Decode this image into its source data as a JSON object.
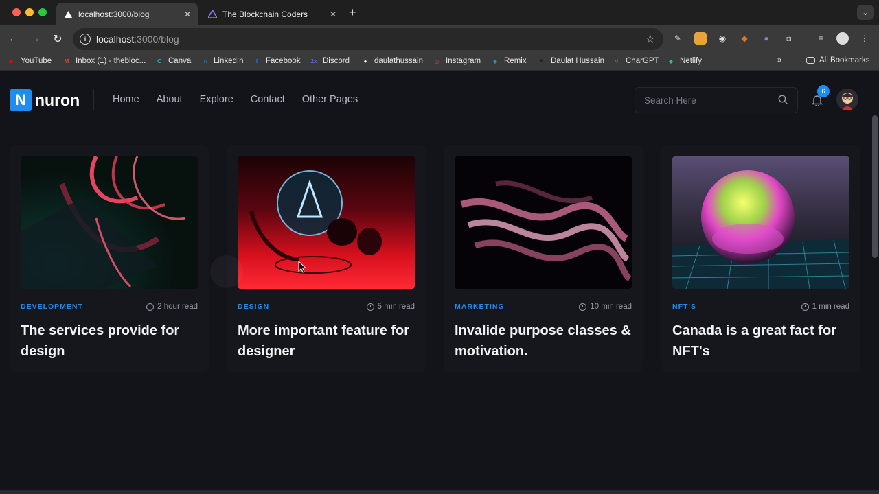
{
  "browser": {
    "tabs": [
      {
        "title": "localhost:3000/blog",
        "active": true
      },
      {
        "title": "The Blockchain Coders",
        "active": false
      }
    ],
    "address": {
      "host": "localhost",
      "path": ":3000/blog"
    },
    "bookmarks": [
      {
        "label": "YouTube",
        "icon": "youtube-icon",
        "color": "#ff0000"
      },
      {
        "label": "Inbox (1) - thebloc...",
        "icon": "gmail-icon",
        "color": "#ea4335"
      },
      {
        "label": "Canva",
        "icon": "canva-icon",
        "color": "#00c4cc"
      },
      {
        "label": "LinkedIn",
        "icon": "linkedin-icon",
        "color": "#0a66c2"
      },
      {
        "label": "Facebook",
        "icon": "facebook-icon",
        "color": "#1877f2"
      },
      {
        "label": "Discord",
        "icon": "discord-icon",
        "color": "#5865f2"
      },
      {
        "label": "daulathussain",
        "icon": "github-icon",
        "color": "#ffffff"
      },
      {
        "label": "Instagram",
        "icon": "instagram-icon",
        "color": "#e1306c"
      },
      {
        "label": "Remix",
        "icon": "remix-icon",
        "color": "#2f8fb5"
      },
      {
        "label": "Daulat Hussain",
        "icon": "profile-icon",
        "color": "#000000"
      },
      {
        "label": "CharGPT",
        "icon": "chatgpt-icon",
        "color": "#ffffff"
      },
      {
        "label": "Netlify",
        "icon": "netlify-icon",
        "color": "#25c2a0"
      }
    ],
    "all_bookmarks": "All Bookmarks"
  },
  "site": {
    "logo_letter": "N",
    "logo_text": "nuron",
    "nav": [
      "Home",
      "About",
      "Explore",
      "Contact",
      "Other Pages"
    ],
    "search_placeholder": "Search Here",
    "notification_count": "6"
  },
  "colors": {
    "accent": "#1e8cf1",
    "background": "#13131a",
    "card": "#16161d"
  },
  "posts": [
    {
      "category": "DEVELOPMENT",
      "read": "2 hour read",
      "title": "The services provide for design"
    },
    {
      "category": "DESIGN",
      "read": "5 min read",
      "title": "More important feature for designer"
    },
    {
      "category": "MARKETING",
      "read": "10 min read",
      "title": "Invalide purpose classes & motivation."
    },
    {
      "category": "NFT'S",
      "read": "1 min read",
      "title": "Canada is a great fact for NFT's"
    }
  ]
}
